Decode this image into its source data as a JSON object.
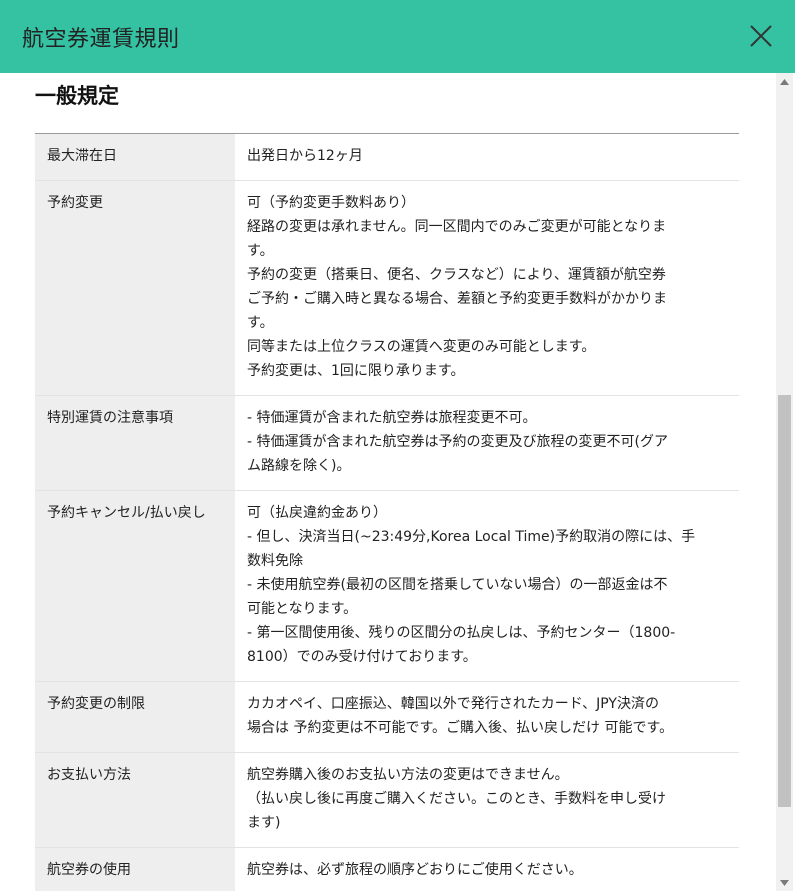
{
  "header": {
    "title": "航空券運賃規則",
    "close_icon": "close-icon"
  },
  "section": {
    "title": "一般規定"
  },
  "rows": [
    {
      "label": "最大滞在日",
      "lines": [
        "出発日から12ヶ月"
      ]
    },
    {
      "label": "予約変更",
      "lines": [
        "可（予約変更手数料あり）",
        "経路の変更は承れません。同一区間内でのみご変更が可能となりま",
        "す。",
        "予約の変更（搭乗日、便名、クラスなど）により、運賃額が航空券",
        "ご予約・ご購入時と異なる場合、差額と予約変更手数料がかかりま",
        "す。",
        "同等または上位クラスの運賃へ変更のみ可能とします。",
        "予約変更は、1回に限り承ります。"
      ]
    },
    {
      "label": "特別運賃の注意事項",
      "lines": [
        "- 特価運賃が含まれた航空券は旅程変更不可。",
        "- 特価運賃が含まれた航空券は予約の変更及び旅程の変更不可(グア",
        "ム路線を除く)。"
      ]
    },
    {
      "label": "予約キャンセル/払い戻し",
      "lines": [
        "可（払戻違約金あり）",
        "- 但し、決済当日(~23:49分,Korea Local Time)予約取消の際には、手",
        "数料免除",
        "- 未使用航空券(最初の区間を搭乗していない場合）の一部返金は不",
        "可能となります。",
        "- 第一区間使用後、残りの区間分の払戻しは、予約センター（1800-",
        "8100）でのみ受け付けております。"
      ]
    },
    {
      "label": "予約変更の制限",
      "lines": [
        "カカオペイ、口座振込、韓国以外で発行されたカード、JPY決済の",
        "場合は 予約変更は不可能です。ご購入後、払い戻しだけ 可能です。"
      ]
    },
    {
      "label": "お支払い方法",
      "lines": [
        "航空券購入後のお支払い方法の変更はできません。",
        "（払い戻し後に再度ご購入ください。このとき、手数料を申し受け",
        "ます)"
      ]
    },
    {
      "label": "航空券の使用",
      "lines": [
        "航空券は、必ず旅程の順序どおりにご使用ください。"
      ]
    }
  ],
  "colors": {
    "header_bg": "#34c2a3",
    "label_bg": "#eeeeee"
  }
}
